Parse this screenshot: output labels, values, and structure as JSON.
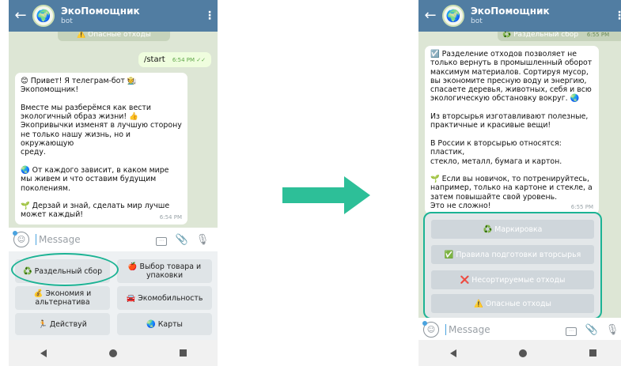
{
  "chat_title": "ЭкоПомощник",
  "chat_subtitle": "bot",
  "input_placeholder": "Message",
  "colors": {
    "header": "#517da2",
    "highlight": "#1cb394",
    "arrow": "#1cb394"
  },
  "left": {
    "pinned": "⚠️ Опасные отходы",
    "outgoing": {
      "text": "/start",
      "time": "6:54 PM"
    },
    "incoming": {
      "text": "😊 Привет! Я телеграм-бот 🧑‍🌾\nЭкопомощник!\n\nВместе мы разберёмся как вести\nэкологичный образ жизни! 👍\nЭкопривычки изменят в лучшую сторону\nне только нашу жизнь, но и окружающую\nсреду.\n\n🌏 От каждого зависит, в каком мире\nмы живем и что оставим будущим\nпоколениям.\n\n🌱 Дерзай и знай, сделать мир лучше\nможет каждый!",
      "time": "6:54 PM"
    },
    "keyboard": [
      "♻️ Раздельный сбор",
      "🍎 Выбор товара и\nупаковки",
      "💰 Экономия и\nальтернатива",
      "🚘 Экомобильность",
      "🏃 Действуй",
      "🌏 Карты"
    ]
  },
  "right": {
    "pinned": "♻️ Раздельный сбор",
    "pinned_time": "6:55 PM",
    "incoming": {
      "text": "☑️ Разделение отходов позволяет не\nтолько вернуть в промышленный оборот\nмаксимум материалов. Сортируя мусор,\nвы экономите пресную воду и энергию,\nспасаете деревья, животных, себя и всю\nэкологическую обстановку вокруг. 🌏\n\nИз вторсырья изготавливают полезные,\nпрактичные и красивые вещи!\n\nВ России к вторсырью относятся: пластик,\nстекло, металл, бумага и картон.\n\n🌱 Если вы новичок, то потренируйтесь,\nнапример, только на картоне и стекле, а\nзатем повышайте свой уровень.\nЭто не сложно!",
      "time": "6:55 PM"
    },
    "keyboard": [
      "♻️ Маркировка",
      "✅ Правила подготовки вторсырья",
      "❌ Несортируемые отходы",
      "⚠️ Опасные отходы"
    ]
  }
}
